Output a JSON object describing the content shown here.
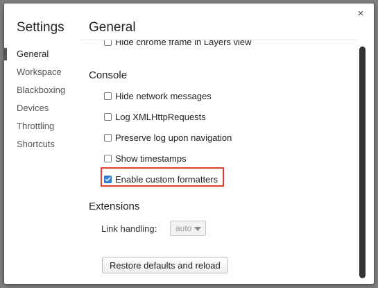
{
  "dialog": {
    "sidebar_title": "Settings",
    "main_title": "General",
    "close_glyph": "×"
  },
  "sidebar": {
    "items": [
      {
        "label": "General",
        "active": true
      },
      {
        "label": "Workspace",
        "active": false
      },
      {
        "label": "Blackboxing",
        "active": false
      },
      {
        "label": "Devices",
        "active": false
      },
      {
        "label": "Throttling",
        "active": false
      },
      {
        "label": "Shortcuts",
        "active": false
      }
    ]
  },
  "content": {
    "partial_row": {
      "label": "Hide chrome frame in Layers view",
      "checked": false
    },
    "console": {
      "title": "Console",
      "options": [
        {
          "label": "Hide network messages",
          "checked": false
        },
        {
          "label": "Log XMLHttpRequests",
          "checked": false
        },
        {
          "label": "Preserve log upon navigation",
          "checked": false
        },
        {
          "label": "Show timestamps",
          "checked": false
        },
        {
          "label": "Enable custom formatters",
          "checked": true
        }
      ]
    },
    "extensions": {
      "title": "Extensions",
      "link_handling_label": "Link handling:",
      "link_handling_value": "auto"
    },
    "restore_button": "Restore defaults and reload"
  },
  "colors": {
    "highlight": "#e0402f",
    "checkbox_checked": "#2f7de1"
  }
}
